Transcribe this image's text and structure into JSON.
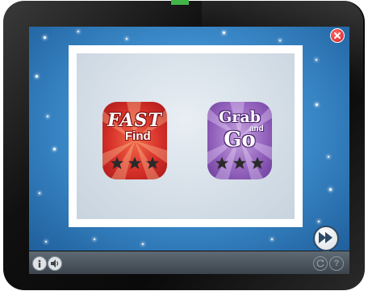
{
  "games": {
    "fast_find": {
      "title_line1": "FAST",
      "title_line2": "Find",
      "rating_filled": 0,
      "rating_max": 3
    },
    "grab_and_go": {
      "title_line1": "Grab",
      "title_line2": "and",
      "title_line3": "Go",
      "rating_filled": 0,
      "rating_max": 3
    }
  },
  "controls": {
    "close_icon": "close-icon",
    "next_icon": "fast-forward-icon",
    "info_icon": "info-icon",
    "sound_icon": "speaker-icon",
    "refresh_icon": "refresh-icon",
    "help_label": "?"
  },
  "colors": {
    "fast_find": "#d8312a",
    "grab_and_go": "#9565bf",
    "sky": "#3f8fcf",
    "accent_green": "#43b649"
  }
}
